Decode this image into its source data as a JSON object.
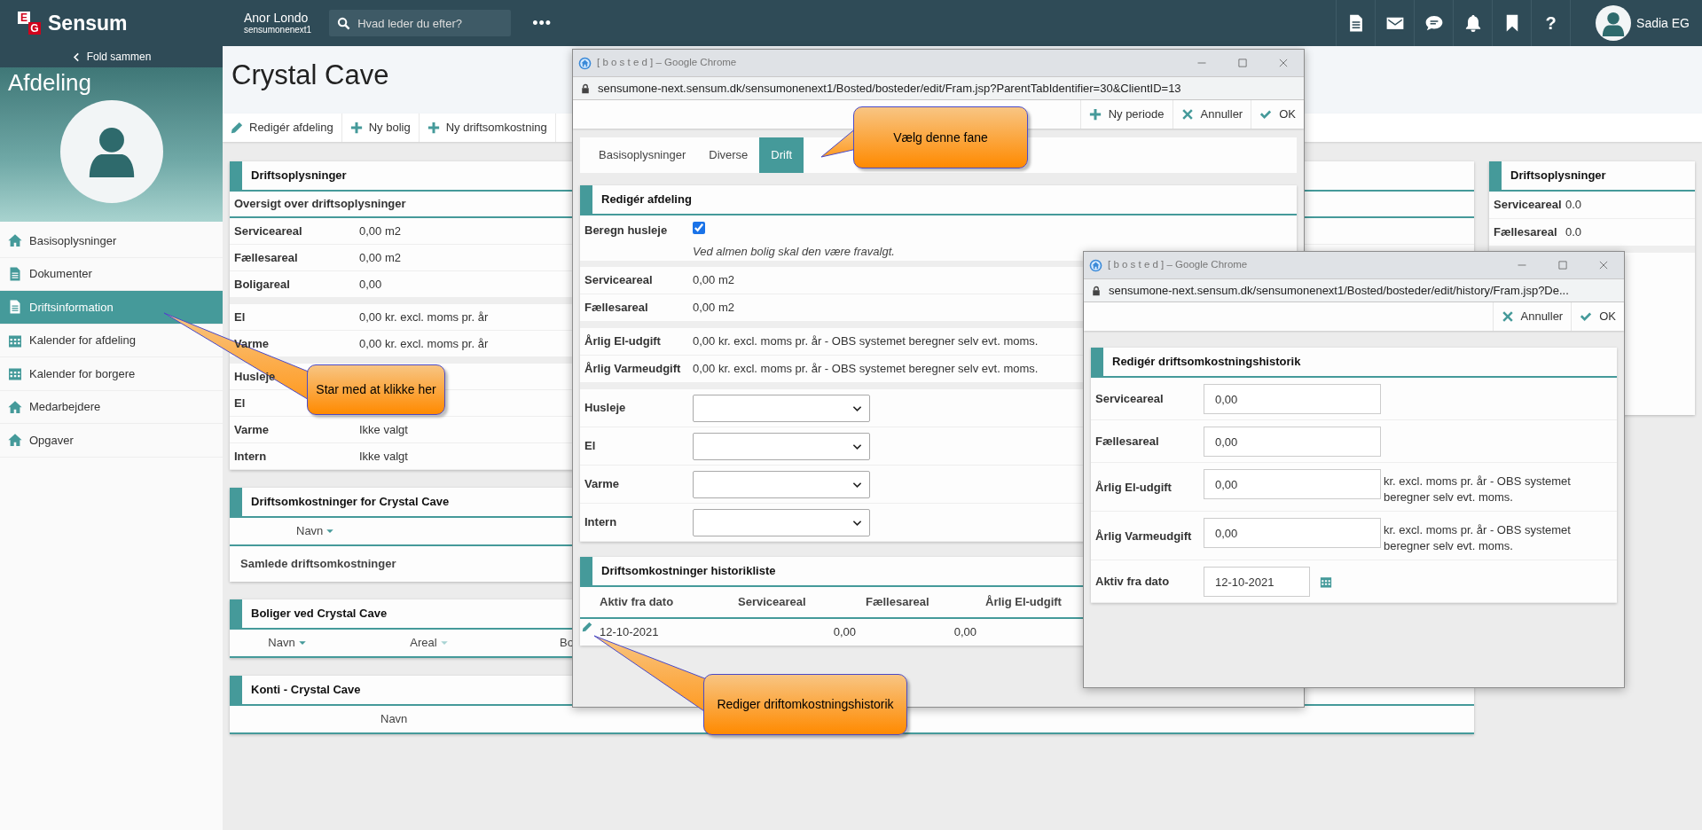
{
  "topbar": {
    "logo": {
      "letters": [
        "E",
        "G"
      ],
      "name": "Sensum"
    },
    "location": "Anor Londo",
    "tenant": "sensumonenext1",
    "search": {
      "placeholder": "Hvad leder du efter?"
    },
    "more_button": "•••",
    "help_button": "?",
    "user": {
      "name": "Sadia EG"
    }
  },
  "sidebar": {
    "collapse": "Fold sammen",
    "heading": "Afdeling",
    "items": [
      {
        "label": "Basisoplysninger",
        "kind": "home",
        "selected": false
      },
      {
        "label": "Dokumenter",
        "kind": "document",
        "selected": false
      },
      {
        "label": "Driftsinformation",
        "kind": "document",
        "selected": true
      },
      {
        "label": "Kalender for afdeling",
        "kind": "calendar",
        "selected": false
      },
      {
        "label": "Kalender for borgere",
        "kind": "calendar",
        "selected": false
      },
      {
        "label": "Medarbejdere",
        "kind": "home",
        "selected": false
      },
      {
        "label": "Opgaver",
        "kind": "home",
        "selected": false
      }
    ]
  },
  "page": {
    "title": "Crystal Cave",
    "actions": [
      {
        "label": "Redigér afdeling",
        "kind": "edit"
      },
      {
        "label": "Ny bolig",
        "kind": "add"
      },
      {
        "label": "Ny driftsomkostning",
        "kind": "add"
      }
    ]
  },
  "info_card": {
    "title": "Driftsoplysninger",
    "subtitle": "Oversigt over driftsoplysninger",
    "groups": [
      [
        {
          "label": "Serviceareal",
          "value": "0,00 m2"
        },
        {
          "label": "Fællesareal",
          "value": "0,00 m2"
        },
        {
          "label": "Boligareal",
          "value": "0,00"
        }
      ],
      [
        {
          "label": "El",
          "value": "0,00 kr. excl. moms pr. år"
        },
        {
          "label": "Varme",
          "value": "0,00 kr. excl. moms pr. år"
        }
      ],
      [
        {
          "label": "Husleje"
        },
        {
          "label": "El"
        },
        {
          "label": "Varme",
          "value": "Ikke valgt"
        },
        {
          "label": "Intern",
          "value": "Ikke valgt"
        }
      ]
    ]
  },
  "costs_card": {
    "title": "Driftsomkostninger for Crystal Cave",
    "columns": [
      {
        "label": "Navn",
        "sorted": true
      }
    ],
    "rows": [
      "Samlede driftsomkostninger"
    ]
  },
  "housing_card": {
    "title": "Boliger ved Crystal Cave",
    "columns": [
      {
        "label": "Navn",
        "sorted": true
      },
      {
        "label": "Areal",
        "sorted": false
      },
      {
        "label": "Bo"
      }
    ]
  },
  "accounts_card": {
    "title": "Konti - Crystal Cave",
    "columns": [
      {
        "label": "Navn"
      }
    ]
  },
  "summary_card": {
    "title": "Driftsoplysninger",
    "rows": [
      {
        "label": "Serviceareal",
        "value": "0.0"
      },
      {
        "label": "Fællesareal",
        "value": "0.0"
      }
    ]
  },
  "edit_window": {
    "title": "[ b o s t e d ] – Google Chrome",
    "url": "sensumone-next.sensum.dk/sensumonenext1/Bosted/bosteder/edit/Fram.jsp?ParentTabIdentifier=30&ClientID=13",
    "actions": [
      {
        "label": "Ny periode",
        "kind": "add"
      },
      {
        "label": "Annuller",
        "kind": "cancel"
      },
      {
        "label": "OK",
        "kind": "ok"
      }
    ],
    "tabs": [
      {
        "label": "Basisoplysninger",
        "selected": false
      },
      {
        "label": "Diverse",
        "selected": false
      },
      {
        "label": "Drift",
        "selected": true
      }
    ],
    "form": {
      "title": "Redigér afdeling",
      "checkbox": {
        "label": "Beregn husleje",
        "checked": true,
        "hint": "Ved almen bolig skal den være fravalgt."
      },
      "groups": [
        [
          {
            "label": "Serviceareal",
            "value": "0,00 m2"
          },
          {
            "label": "Fællesareal",
            "value": "0,00 m2"
          }
        ],
        [
          {
            "label": "Årlig El-udgift",
            "value": "0,00 kr. excl. moms pr. år - OBS systemet beregner selv evt. moms."
          },
          {
            "label": "Årlig Varmeudgift",
            "value": "0,00 kr. excl. moms pr. år - OBS systemet beregner selv evt. moms."
          }
        ]
      ],
      "selects": [
        {
          "label": "Husleje"
        },
        {
          "label": "El"
        },
        {
          "label": "Varme"
        },
        {
          "label": "Intern"
        }
      ]
    },
    "history": {
      "title": "Driftsomkostninger historikliste",
      "columns": [
        "Aktiv fra dato",
        "Serviceareal",
        "Fællesareal",
        "Årlig El-udgift"
      ],
      "rows": [
        [
          "12-10-2021",
          "0,00",
          "0,00"
        ]
      ]
    }
  },
  "history_window": {
    "title": "[ b o s t e d ] – Google Chrome",
    "url": "sensumone-next.sensum.dk/sensumonenext1/Bosted/bosteder/edit/history/Fram.jsp?De...",
    "actions": [
      {
        "label": "Annuller",
        "kind": "cancel"
      },
      {
        "label": "OK",
        "kind": "ok"
      }
    ],
    "form": {
      "title": "Redigér driftsomkostningshistorik",
      "fields": [
        {
          "label": "Serviceareal",
          "value": "0,00",
          "kind": "number"
        },
        {
          "label": "Fællesareal",
          "value": "0,00",
          "kind": "number"
        },
        {
          "label": "Årlig El-udgift",
          "value": "0,00",
          "kind": "number",
          "note": "kr. excl. moms pr. år - OBS systemet beregner selv evt. moms."
        },
        {
          "label": "Årlig Varmeudgift",
          "value": "0,00",
          "kind": "number",
          "note": "kr. excl. moms pr. år - OBS systemet beregner selv evt. moms."
        },
        {
          "label": "Aktiv fra dato",
          "value": "12-10-2021",
          "kind": "date"
        }
      ]
    }
  },
  "callouts": [
    {
      "text": "Star med at klikke her"
    },
    {
      "text": "Vælg denne fane"
    },
    {
      "text": "Rediger driftomkostningshistorik"
    }
  ]
}
